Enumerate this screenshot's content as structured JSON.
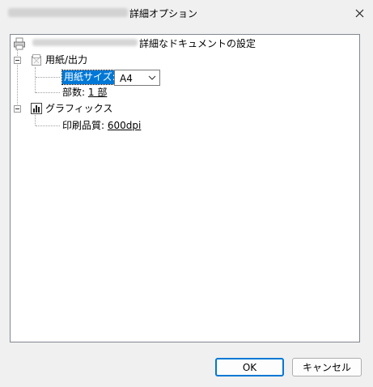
{
  "dialog": {
    "title_suffix": "詳細オプション",
    "close_glyph": "✕"
  },
  "tree": {
    "root": {
      "label": "詳細なドキュメントの設定"
    },
    "paper_output": {
      "label": "用紙/出力",
      "paper_size": {
        "label": "用紙サイズ:",
        "value": "A4"
      },
      "copies": {
        "label": "部数:",
        "value": "1 部"
      }
    },
    "graphics": {
      "label": "グラフィックス",
      "print_quality": {
        "label": "印刷品質:",
        "value": "600dpi"
      }
    }
  },
  "buttons": {
    "ok": "OK",
    "cancel": "キャンセル"
  },
  "colors": {
    "selection": "#0078d7",
    "default_button_border": "#0078d4"
  }
}
